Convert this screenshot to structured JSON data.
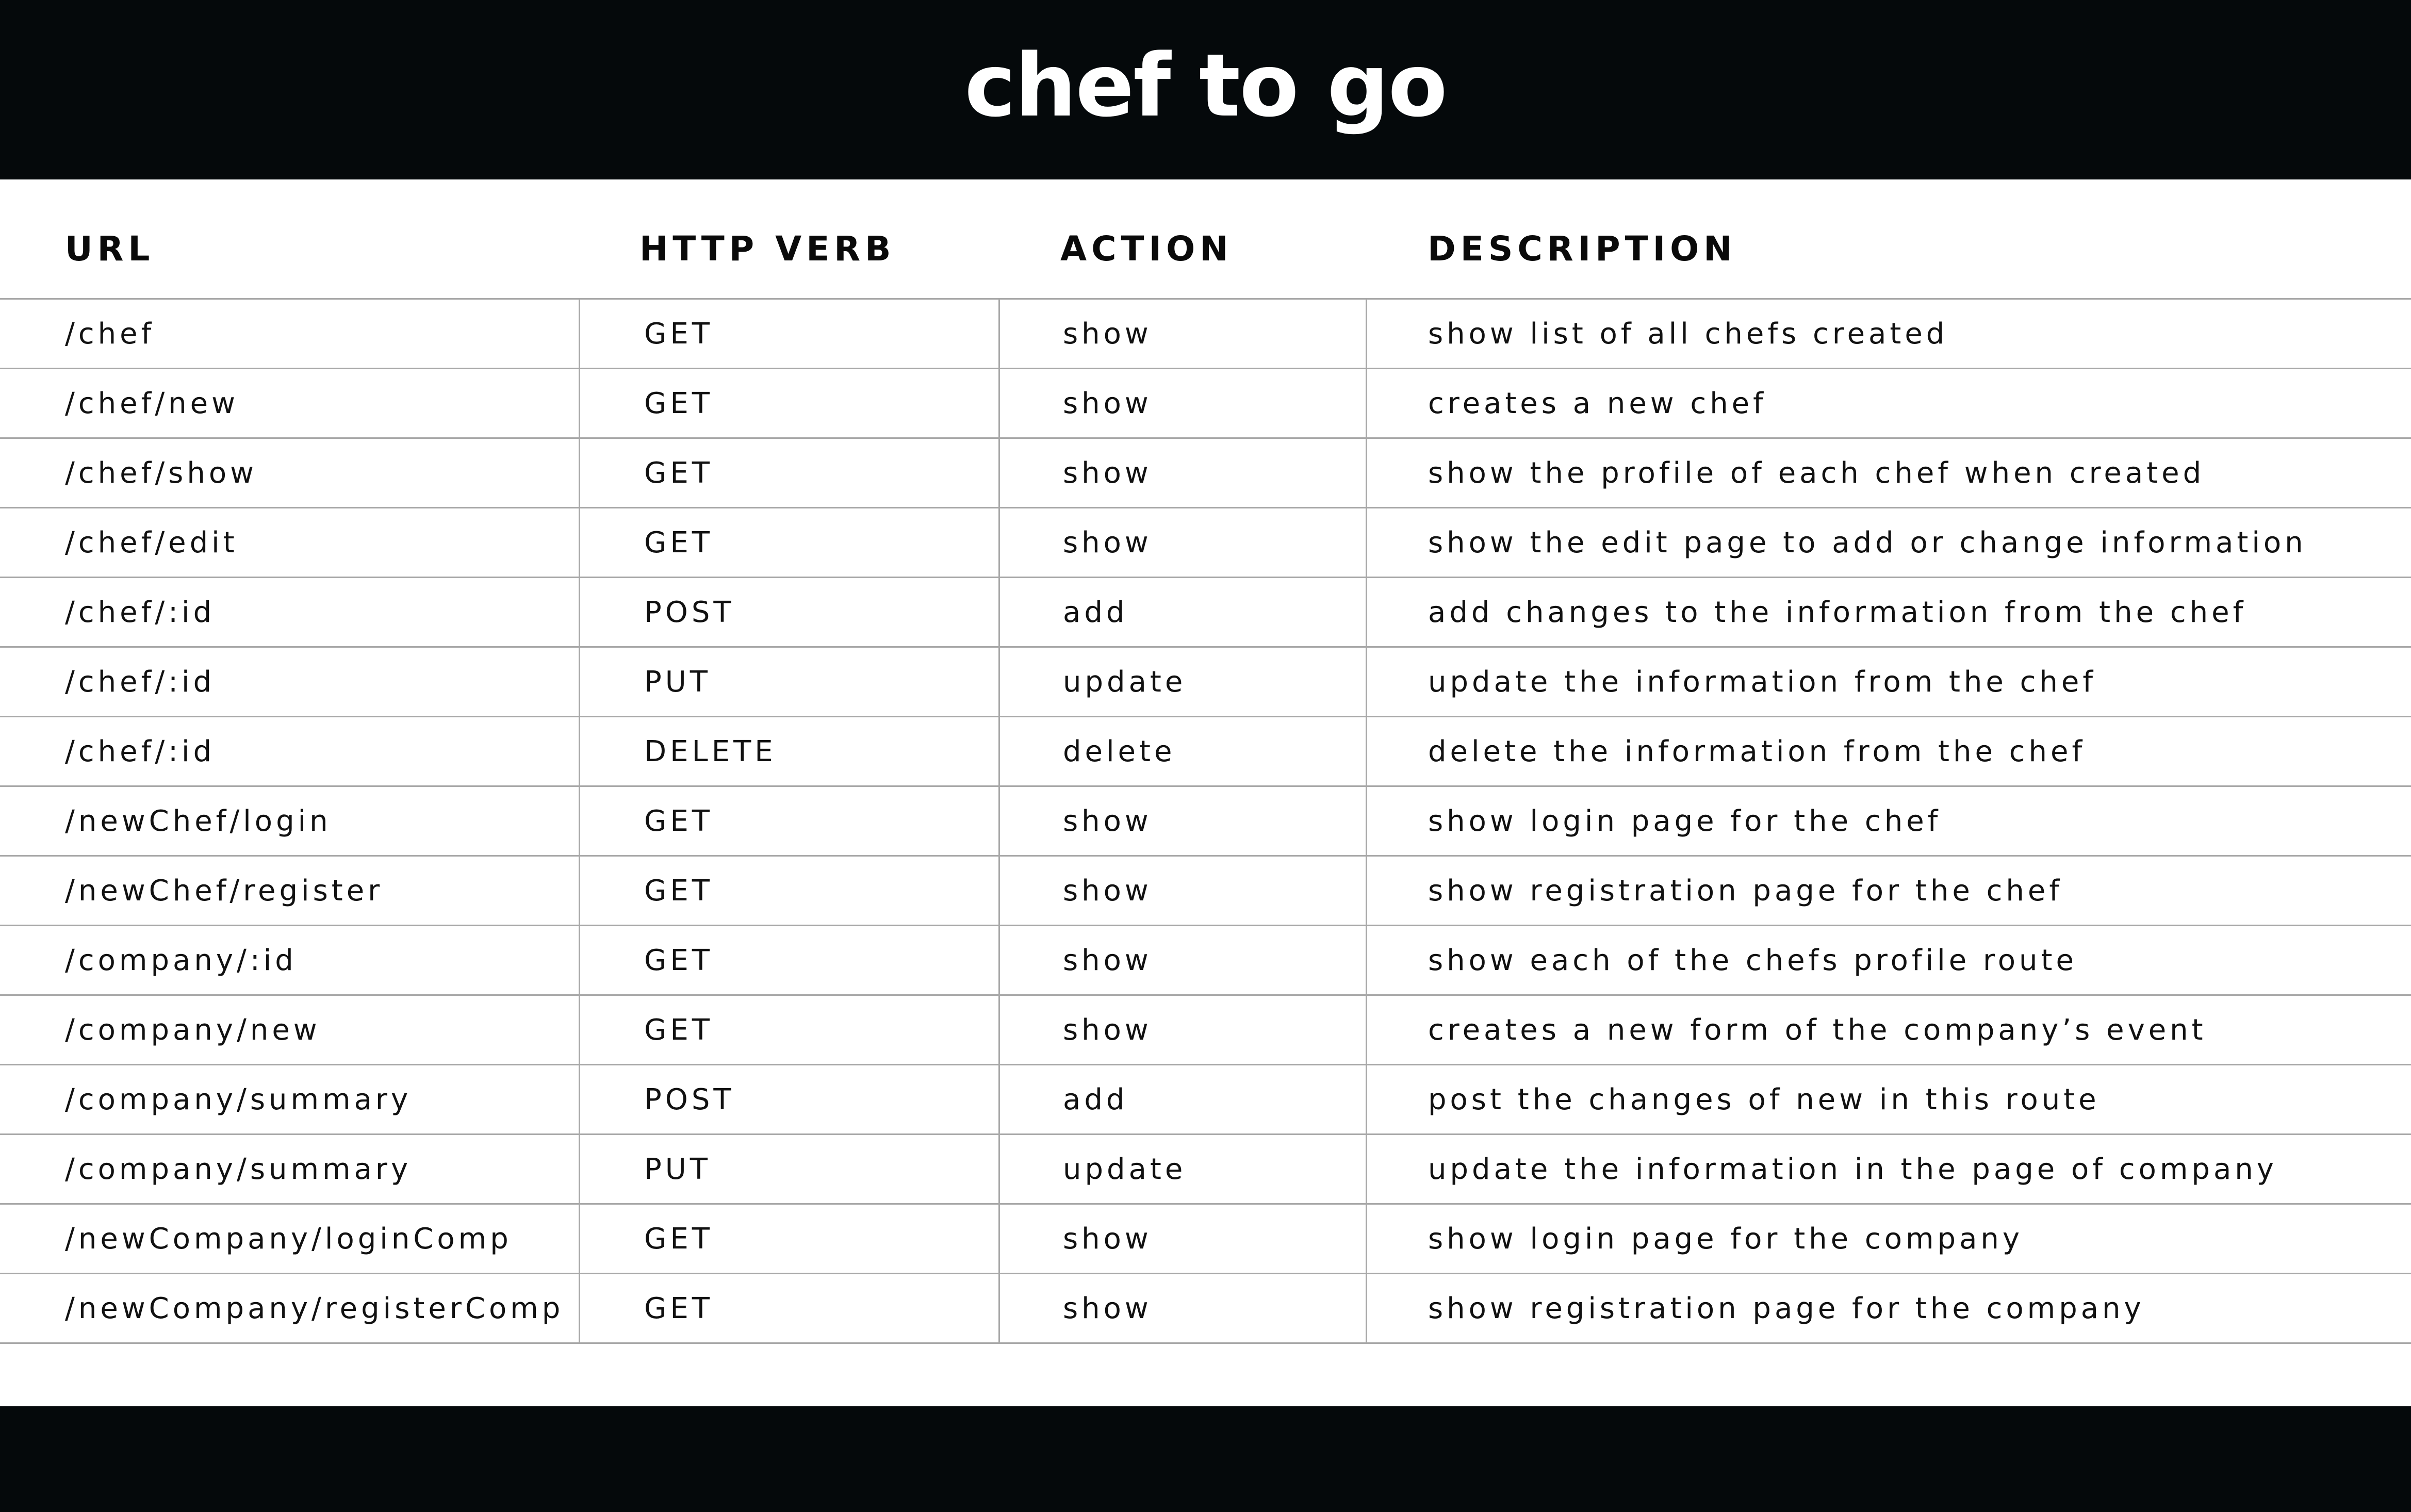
{
  "title": "chef to go",
  "colors": {
    "bar": "#05090b",
    "background": "#ffffff",
    "rule": "#a8a8a8",
    "text": "#111111"
  },
  "columns": {
    "url": "URL",
    "verb": "HTTP VERB",
    "action": "ACTION",
    "description": "DESCRIPTION"
  },
  "rows": [
    {
      "url": "/chef",
      "verb": "GET",
      "action": "show",
      "description": "show list of all chefs created"
    },
    {
      "url": "/chef/new",
      "verb": "GET",
      "action": "show",
      "description": "creates a new chef"
    },
    {
      "url": "/chef/show",
      "verb": "GET",
      "action": "show",
      "description": "show the profile of each chef when created"
    },
    {
      "url": "/chef/edit",
      "verb": "GET",
      "action": "show",
      "description": "show the edit page to add or change information"
    },
    {
      "url": "/chef/:id",
      "verb": "POST",
      "action": "add",
      "description": "add changes to the information from the chef"
    },
    {
      "url": "/chef/:id",
      "verb": "PUT",
      "action": "update",
      "description": "update the information from the chef"
    },
    {
      "url": "/chef/:id",
      "verb": "DELETE",
      "action": "delete",
      "description": "delete the information from the chef"
    },
    {
      "url": "/newChef/login",
      "verb": "GET",
      "action": "show",
      "description": "show login page for the chef"
    },
    {
      "url": "/newChef/register",
      "verb": "GET",
      "action": "show",
      "description": "show registration page for the chef"
    },
    {
      "url": "/company/:id",
      "verb": "GET",
      "action": "show",
      "description": "show each of the chefs profile route"
    },
    {
      "url": "/company/new",
      "verb": "GET",
      "action": "show",
      "description": "creates a new form of the company’s event"
    },
    {
      "url": "/company/summary",
      "verb": "POST",
      "action": "add",
      "description": "post the changes of new in this route"
    },
    {
      "url": "/company/summary",
      "verb": "PUT",
      "action": "update",
      "description": "update the information in the page of company"
    },
    {
      "url": "/newCompany/loginComp",
      "verb": "GET",
      "action": "show",
      "description": "show login page for the company"
    },
    {
      "url": "/newCompany/registerComp",
      "verb": "GET",
      "action": "show",
      "description": "show registration page for the company"
    }
  ]
}
